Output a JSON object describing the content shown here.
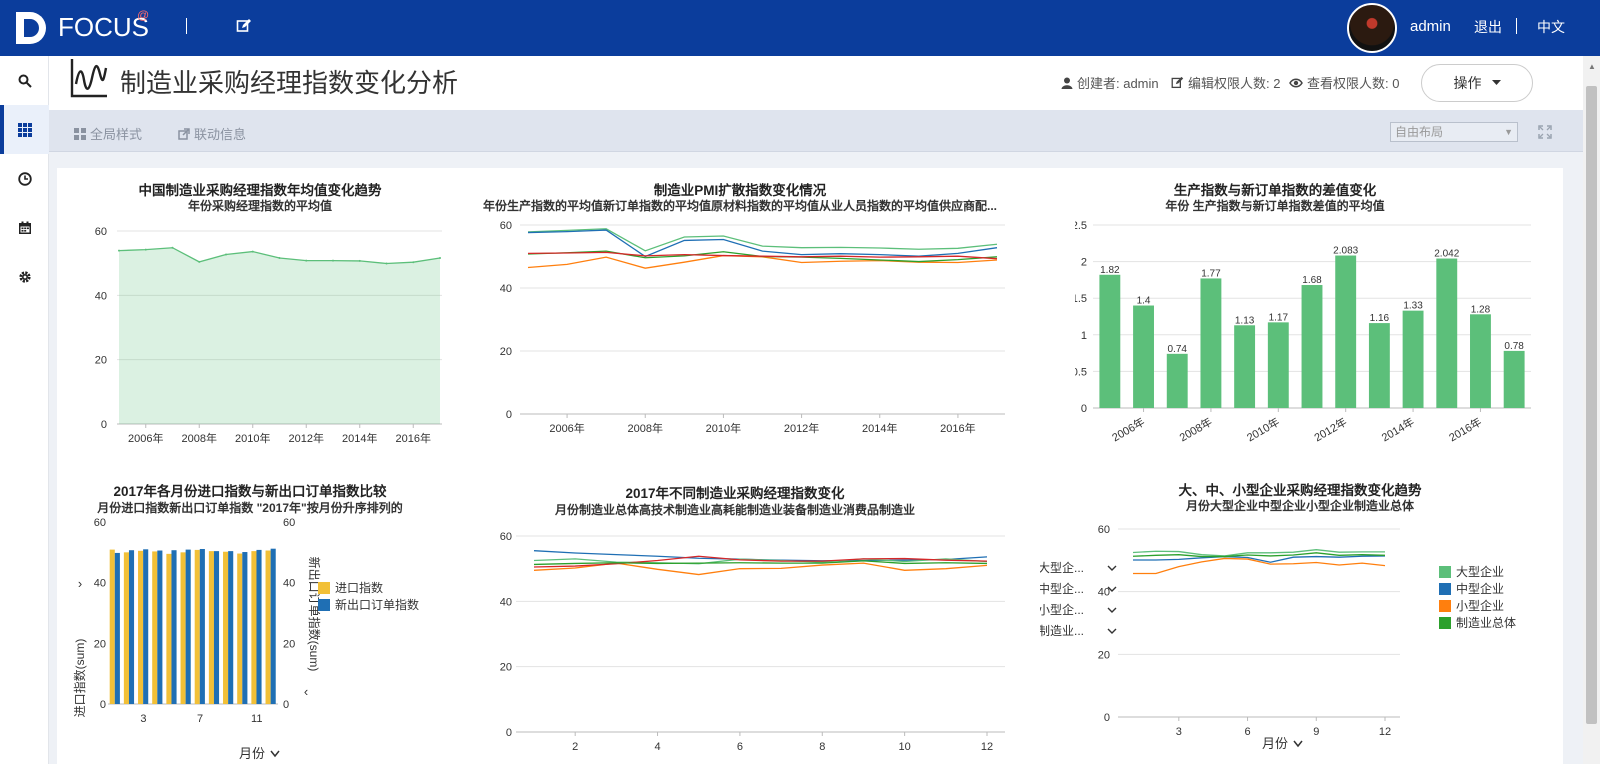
{
  "topbar": {
    "logo_text": "FOCUS",
    "logo_superscript": "@",
    "user": "admin",
    "logout": "退出",
    "language": "中文"
  },
  "page": {
    "title": "制造业采购经理指数变化分析",
    "creator": "创建者: admin",
    "edit_count": "编辑权限人数: 2",
    "view_count": "查看权限人数: 0",
    "operation_button": "操作"
  },
  "toolbar": {
    "global_style": "全局样式",
    "link_info": "联动信息",
    "layout_select": "自由布局"
  },
  "sidebar": [
    "search-icon",
    "grid-icon",
    "clock-icon",
    "calendar-icon",
    "gear-icon"
  ],
  "chart_data": [
    {
      "type": "area",
      "title": "中国制造业采购经理指数年均值变化趋势",
      "subtitle": "年份采购经理指数的平均值",
      "x": [
        "2005年",
        "2006年",
        "2007年",
        "2008年",
        "2009年",
        "2010年",
        "2011年",
        "2012年",
        "2013年",
        "2014年",
        "2015年",
        "2016年",
        "2017年"
      ],
      "x_ticks": [
        "2006年",
        "2008年",
        "2010年",
        "2012年",
        "2014年",
        "2016年"
      ],
      "values": [
        53.9,
        54.2,
        54.8,
        50.4,
        52.7,
        53.6,
        51.6,
        50.8,
        50.8,
        50.7,
        49.9,
        50.3,
        51.6
      ],
      "ylim": [
        0,
        60
      ],
      "y_ticks": [
        0,
        20,
        40,
        60
      ],
      "color": "#5cbf7a"
    },
    {
      "type": "line",
      "title": "制造业PMI扩散指数变化情况",
      "subtitle": "年份生产指数的平均值新订单指数的平均值原材料指数的平均值从业人员指数的平均值供应商配...",
      "x": [
        "2005年",
        "2006年",
        "2007年",
        "2008年",
        "2009年",
        "2010年",
        "2011年",
        "2012年",
        "2013年",
        "2014年",
        "2015年",
        "2016年",
        "2017年"
      ],
      "x_ticks": [
        "2006年",
        "2008年",
        "2010年",
        "2012年",
        "2014年",
        "2016年"
      ],
      "ylim": [
        0,
        60
      ],
      "y_ticks": [
        0,
        20,
        40,
        60
      ],
      "series": [
        {
          "color": "#5cbf7a",
          "values": [
            57.8,
            58.3,
            58.8,
            51.8,
            56.2,
            56.5,
            53.3,
            52.8,
            52.9,
            52.7,
            52.3,
            52.6,
            53.9
          ]
        },
        {
          "color": "#1f6fb4",
          "values": [
            57.6,
            57.9,
            58.4,
            50.0,
            55.1,
            55.4,
            51.7,
            50.6,
            50.9,
            50.6,
            50.1,
            51.0,
            52.8
          ]
        },
        {
          "color": "#ff7f0e",
          "values": [
            46.5,
            47.5,
            49.8,
            46.3,
            48.2,
            50.3,
            49.9,
            48.1,
            48.5,
            48.7,
            48.2,
            48.1,
            48.9
          ]
        },
        {
          "color": "#2ca02c",
          "values": [
            50.8,
            51.2,
            51.7,
            49.6,
            50.2,
            51.5,
            50.0,
            49.8,
            49.4,
            48.9,
            48.4,
            49.0,
            49.9
          ]
        },
        {
          "color": "#d62728",
          "values": [
            51.0,
            51.1,
            51.3,
            50.2,
            50.6,
            50.3,
            50.1,
            49.9,
            50.1,
            49.8,
            49.9,
            50.1,
            49.3
          ]
        }
      ]
    },
    {
      "type": "bar",
      "title": "生产指数与新订单指数的差值变化",
      "subtitle": "年份 生产指数与新订单指数差值的平均值",
      "categories": [
        "2005年",
        "2006年",
        "2007年",
        "2008年",
        "2009年",
        "2010年",
        "2011年",
        "2012年",
        "2013年",
        "2014年",
        "2015年",
        "2016年",
        "2017年"
      ],
      "x_ticks": [
        "2006年",
        "2008年",
        "2010年",
        "2012年",
        "2014年",
        "2016年"
      ],
      "values": [
        1.82,
        1.4,
        0.74,
        1.77,
        1.13,
        1.17,
        1.68,
        2.083,
        1.16,
        1.33,
        2.042,
        1.28,
        0.78
      ],
      "labels": [
        "1.82",
        "1.4",
        "0.74",
        "1.77",
        "1.13",
        "1.17",
        "1.68",
        "2.083",
        "1.16",
        "1.33",
        "2.042",
        "1.28",
        "0.78"
      ],
      "ylim": [
        0,
        2.5
      ],
      "y_ticks": [
        "0",
        "0.5",
        "1",
        "1.5",
        "2",
        "2.5"
      ],
      "color": "#5cbf7a"
    },
    {
      "type": "bar",
      "title": "2017年各月份进口指数与新出口订单指数比较",
      "subtitle": "月份进口指数新出口订单指数 \"2017年\"按月份升序排列的",
      "categories": [
        1,
        2,
        3,
        4,
        5,
        6,
        7,
        8,
        9,
        10,
        11,
        12
      ],
      "x_ticks": [
        "3",
        "7",
        "11"
      ],
      "xlabel": "月份",
      "ylabel_left": "进口指数(sum)",
      "ylabel_right": "新出口订单指数(sum)",
      "ylim": [
        0,
        60
      ],
      "y_ticks": [
        0,
        20,
        40,
        60
      ],
      "series": [
        {
          "name": "进口指数",
          "color": "#f2c037",
          "values": [
            50.9,
            50.0,
            50.5,
            50.3,
            49.5,
            50.0,
            50.8,
            50.4,
            50.2,
            49.6,
            50.4,
            50.6
          ]
        },
        {
          "name": "新出口订单指数",
          "color": "#1f6fb4",
          "values": [
            49.8,
            50.7,
            51.0,
            50.6,
            50.7,
            50.9,
            51.1,
            50.4,
            50.4,
            50.1,
            50.8,
            51.2
          ]
        }
      ]
    },
    {
      "type": "line",
      "title": "2017年不同制造业采购经理指数变化",
      "subtitle": "月份制造业总体高技术制造业高耗能制造业装备制造业消费品制造业",
      "x": [
        1,
        2,
        3,
        4,
        5,
        6,
        7,
        8,
        9,
        10,
        11,
        12
      ],
      "x_ticks": [
        "2",
        "4",
        "6",
        "8",
        "10",
        "12"
      ],
      "ylim": [
        0,
        60
      ],
      "y_ticks": [
        0,
        20,
        40,
        60
      ],
      "series": [
        {
          "color": "#1f6fb4",
          "values": [
            55.5,
            54.8,
            54.3,
            53.8,
            53.2,
            52.9,
            52.6,
            52.4,
            52.5,
            52.6,
            52.8,
            53.6
          ]
        },
        {
          "color": "#5cbf7a",
          "values": [
            52.5,
            53.0,
            52.0,
            51.8,
            51.5,
            52.9,
            52.5,
            52.0,
            53.0,
            52.2,
            53.0,
            52.2
          ]
        },
        {
          "color": "#ff7f0e",
          "values": [
            49.5,
            50.2,
            51.7,
            49.8,
            48.2,
            50.0,
            50.1,
            51.1,
            51.7,
            49.5,
            50.0,
            51.0
          ]
        },
        {
          "color": "#d62728",
          "values": [
            50.5,
            50.8,
            51.5,
            52.5,
            53.8,
            52.7,
            52.3,
            52.3,
            53.0,
            53.1,
            52.6,
            52.3
          ]
        },
        {
          "color": "#2ca02c",
          "values": [
            51.3,
            51.6,
            51.8,
            51.6,
            51.7,
            51.8,
            51.7,
            51.7,
            52.4,
            51.6,
            51.8,
            51.6
          ]
        }
      ]
    },
    {
      "type": "line",
      "title": "大、中、小型企业采购经理指数变化趋势",
      "subtitle": "月份大型企业中型企业小型企业制造业总体",
      "x": [
        1,
        2,
        3,
        4,
        5,
        6,
        7,
        8,
        9,
        10,
        11,
        12
      ],
      "x_ticks": [
        "3",
        "6",
        "9",
        "12"
      ],
      "xlabel": "月份",
      "ylim": [
        0,
        60
      ],
      "y_ticks": [
        0,
        20,
        40,
        60
      ],
      "left_fields": [
        "大型企...",
        "中型企...",
        "小型企...",
        "制造业..."
      ],
      "series": [
        {
          "name": "大型企业",
          "color": "#5cbf7a",
          "values": [
            52.5,
            52.9,
            52.8,
            51.8,
            51.4,
            52.4,
            52.4,
            52.6,
            53.4,
            52.6,
            52.7,
            52.7
          ]
        },
        {
          "name": "中型企业",
          "color": "#1f6fb4",
          "values": [
            50.1,
            50.1,
            50.3,
            50.8,
            51.2,
            50.9,
            49.4,
            51.0,
            51.2,
            51.0,
            51.3,
            51.4
          ]
        },
        {
          "name": "小型企业",
          "color": "#ff7f0e",
          "values": [
            45.8,
            45.8,
            48.0,
            49.5,
            50.6,
            50.4,
            48.8,
            48.9,
            49.3,
            48.5,
            49.1,
            48.3
          ]
        },
        {
          "name": "制造业总体",
          "color": "#2ca02c",
          "values": [
            51.3,
            51.6,
            51.8,
            51.2,
            51.2,
            51.7,
            51.4,
            51.7,
            52.4,
            51.6,
            51.8,
            51.6
          ]
        }
      ]
    }
  ]
}
